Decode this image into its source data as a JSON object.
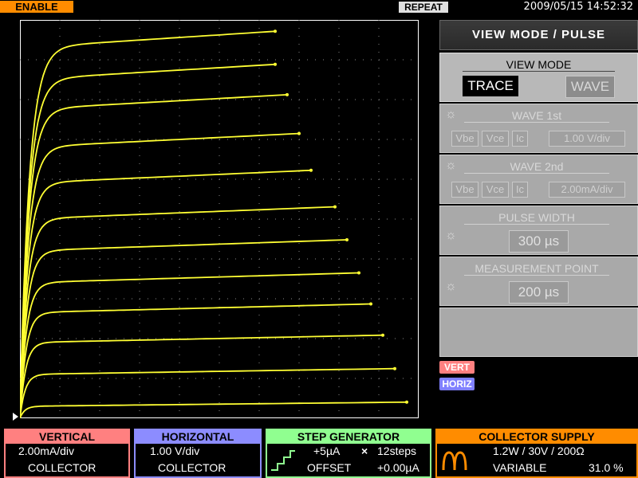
{
  "topbar": {
    "enable_label": "ENABLE",
    "repeat_label": "REPEAT",
    "datetime": "2009/05/15 14:52:32"
  },
  "chart_data": {
    "type": "line",
    "xlabel": "",
    "ylabel": "",
    "x_per_div": 1.0,
    "y_per_div": 2.0,
    "xlim": [
      0,
      10
    ],
    "ylim": [
      0,
      20
    ],
    "grid": true,
    "trace_color": "#ffff33",
    "series": [
      {
        "end_x": 9.7,
        "level": 0.6
      },
      {
        "end_x": 9.4,
        "level": 2.2
      },
      {
        "end_x": 9.1,
        "level": 3.8
      },
      {
        "end_x": 8.8,
        "level": 5.3
      },
      {
        "end_x": 8.5,
        "level": 6.8
      },
      {
        "end_x": 8.2,
        "level": 8.4
      },
      {
        "end_x": 7.9,
        "level": 10.0
      },
      {
        "end_x": 7.3,
        "level": 11.8
      },
      {
        "end_x": 7.0,
        "level": 13.6
      },
      {
        "end_x": 6.7,
        "level": 15.5
      },
      {
        "end_x": 6.4,
        "level": 17.0
      },
      {
        "end_x": 6.4,
        "level": 18.6
      }
    ]
  },
  "panel": {
    "header": "VIEW MODE / PULSE",
    "view_mode": {
      "title": "VIEW MODE",
      "trace": "TRACE",
      "wave": "WAVE"
    },
    "wave1": {
      "title": "WAVE 1st",
      "opt1": "Vbe",
      "opt2": "Vce",
      "opt3": "Ic",
      "value": "1.00 V/div"
    },
    "wave2": {
      "title": "WAVE 2nd",
      "opt1": "Vbe",
      "opt2": "Vce",
      "opt3": "Ic",
      "value": "2.00mA/div"
    },
    "pulse_width": {
      "title": "PULSE WIDTH",
      "value": "300 µs"
    },
    "measurement_point": {
      "title": "MEASUREMENT POINT",
      "value": "200 µs"
    },
    "vert_tag": "VERT",
    "horiz_tag": "HORIZ"
  },
  "bottom": {
    "vertical": {
      "title": "VERTICAL",
      "line1": "2.00mA/div",
      "line2": "COLLECTOR"
    },
    "horizontal": {
      "title": "HORIZONTAL",
      "line1": "1.00 V/div",
      "line2": "COLLECTOR"
    },
    "step": {
      "title": "STEP GENERATOR",
      "step": "+5µA",
      "times": "×",
      "steps": "12steps",
      "offset_label": "OFFSET",
      "offset_value": "+0.00µA"
    },
    "collector": {
      "title": "COLLECTOR SUPPLY",
      "line1": "1.2W / 30V / 200Ω",
      "variable_label": "VARIABLE",
      "variable_value": "31.0 %"
    }
  },
  "icons": {
    "gear": "☼",
    "staircase": "staircase-icon",
    "collector_wave": "rectified-wave-icon"
  }
}
